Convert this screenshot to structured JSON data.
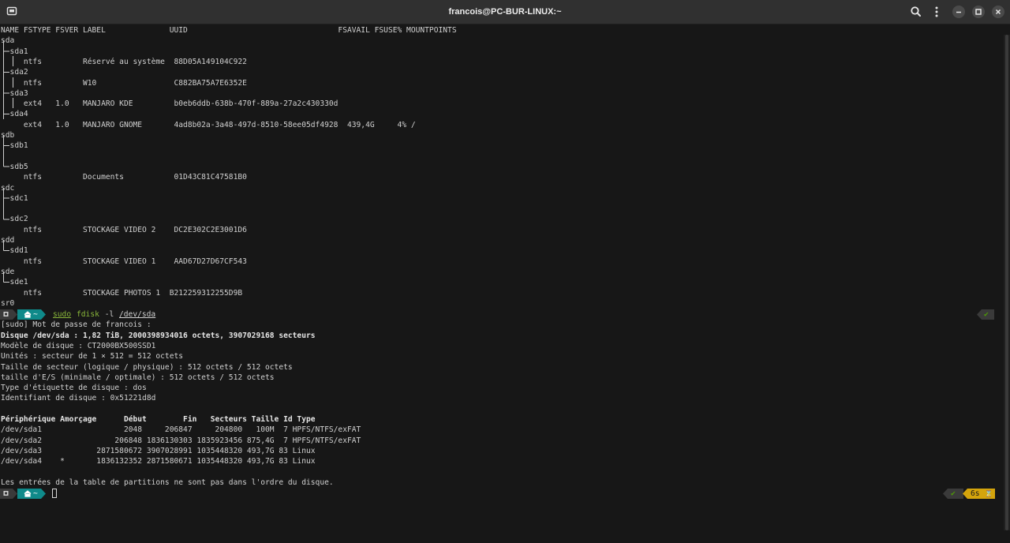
{
  "window": {
    "title": "francois@PC-BUR-LINUX:~",
    "new_tab_icon": "new-tab-icon",
    "search_icon": "search-icon",
    "menu_icon": "kebab-menu-icon",
    "minimize_icon": "minimize-icon",
    "maximize_icon": "maximize-icon",
    "close_icon": "close-icon"
  },
  "colors": {
    "background": "#171717",
    "titlebar": "#303030",
    "prompt_teal": "#0f8a8a",
    "prompt_dark": "#3a3a3a",
    "ok_green": "#4e9a06",
    "timer_yellow": "#d4a40c",
    "command_green": "#8ab83a"
  },
  "lsblk": {
    "header": "NAME FSTYPE FSVER LABEL              UUID                                 FSAVAIL FSUSE% MOUNTPOINTS",
    "lines": [
      "sda",
      "  sda1",
      "     ntfs         Réservé au système  88D05A149104C922",
      "  sda2",
      "     ntfs         W10                 C882BA75A7E6352E",
      "  sda3",
      "     ext4   1.0   MANJARO KDE         b0eb6ddb-638b-470f-889a-27a2c430330d",
      "  sda4",
      "     ext4   1.0   MANJARO GNOME       4ad8b02a-3a48-497d-8510-58ee05df4928  439,4G     4% /",
      "sdb",
      "  sdb1",
      "",
      "  sdb5",
      "     ntfs         Documents           01D43C81C47581B0",
      "sdc",
      "  sdc1",
      "",
      "  sdc2",
      "     ntfs         STOCKAGE VIDEO 2    DC2E302C2E3001D6",
      "sdd",
      "  sdd1",
      "     ntfs         STOCKAGE VIDEO 1    AAD67D27D67CF543",
      "sde",
      "  sde1",
      "     ntfs         STOCKAGE PHOTOS 1  B212259312255D9B",
      "sr0"
    ]
  },
  "prompt1": {
    "dir": "~",
    "cmd_sudo": "sudo",
    "cmd_name": "fdisk",
    "cmd_args": " -l ",
    "cmd_path": "/dev/sda",
    "status": "✔"
  },
  "fdisk": {
    "sudo_prompt": "[sudo] Mot de passe de francois :",
    "disk_line": "Disque /dev/sda : 1,82 TiB, 2000398934016 octets, 3907029168 secteurs",
    "info_lines": [
      "Modèle de disque : CT2000BX500SSD1",
      "Unités : secteur de 1 × 512 = 512 octets",
      "Taille de secteur (logique / physique) : 512 octets / 512 octets",
      "taille d'E/S (minimale / optimale) : 512 octets / 512 octets",
      "Type d'étiquette de disque : dos",
      "Identifiant de disque : 0x51221d8d"
    ],
    "table_header": "Périphérique Amorçage      Début        Fin   Secteurs Taille Id Type",
    "table_rows": [
      "/dev/sda1                  2048     206847     204800   100M  7 HPFS/NTFS/exFAT",
      "/dev/sda2                206848 1836130303 1835923456 875,4G  7 HPFS/NTFS/exFAT",
      "/dev/sda3            2871580672 3907028991 1035448320 493,7G 83 Linux",
      "/dev/sda4    *       1836132352 2871580671 1035448320 493,7G 83 Linux"
    ],
    "footer": "Les entrées de la table de partitions ne sont pas dans l'ordre du disque."
  },
  "prompt2": {
    "dir": "~",
    "status": "✔",
    "duration": "6s",
    "hourglass": "⌛"
  }
}
